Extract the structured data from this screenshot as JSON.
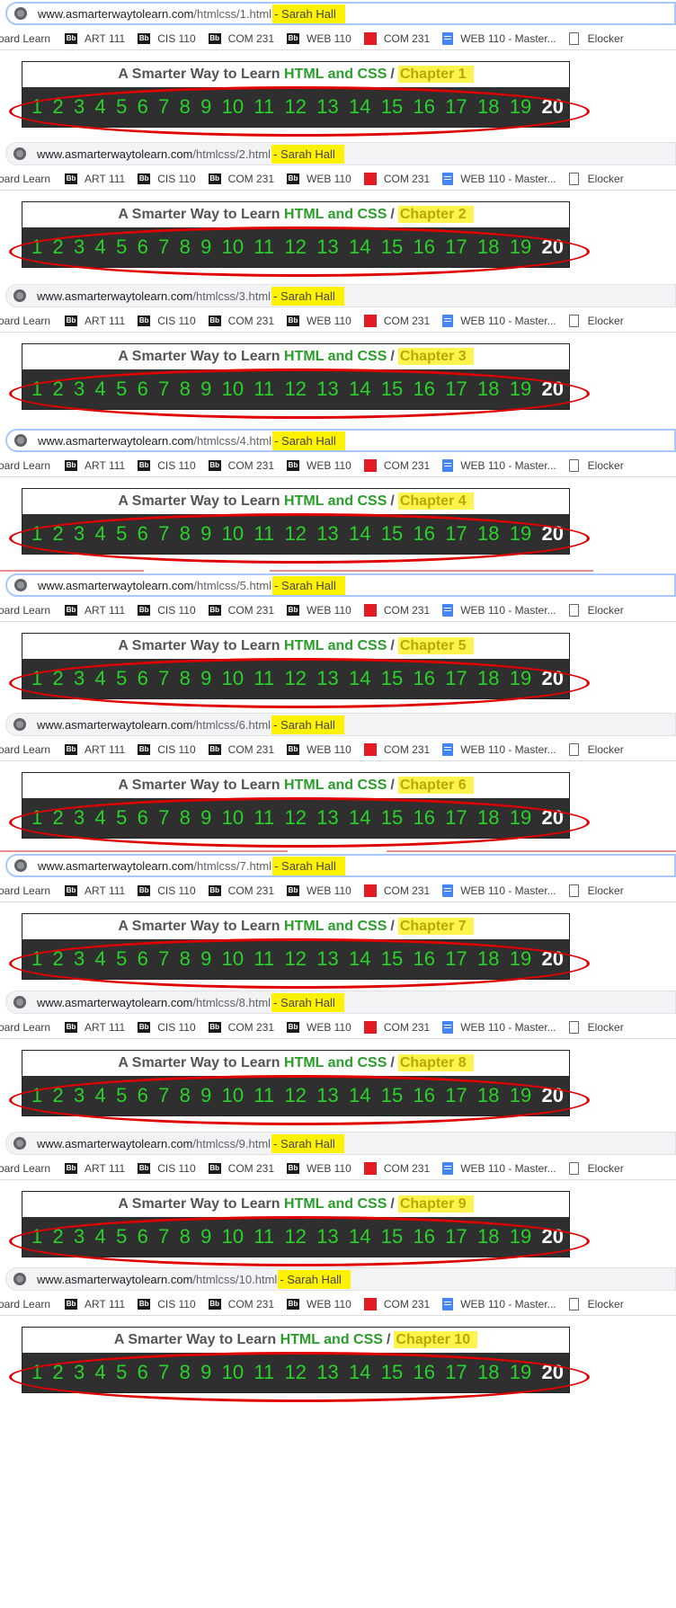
{
  "site": {
    "title_pre": "A Smarter Way to Learn",
    "title_green": "HTML and CSS",
    "separator": "/"
  },
  "url_domain": "www.asmarterwaytolearn.com",
  "highlight_text": "- Sarah Hall",
  "bookmarks": [
    {
      "label": "oard Learn",
      "icon": "none"
    },
    {
      "label": "ART 111",
      "icon": "blackboard-icon"
    },
    {
      "label": "CIS 110",
      "icon": "blackboard-icon"
    },
    {
      "label": "COM 231",
      "icon": "blackboard-icon"
    },
    {
      "label": "WEB 110",
      "icon": "blackboard-icon"
    },
    {
      "label": "COM 231",
      "icon": "mcgraw-hill-icon"
    },
    {
      "label": "WEB 110 - Master...",
      "icon": "google-docs-icon"
    },
    {
      "label": "Elocker",
      "icon": "page-icon"
    }
  ],
  "page_numbers": [
    "1",
    "2",
    "3",
    "4",
    "5",
    "6",
    "7",
    "8",
    "9",
    "10",
    "11",
    "12",
    "13",
    "14",
    "15",
    "16",
    "17",
    "18",
    "19",
    "20"
  ],
  "current_page": "20",
  "colors": {
    "highlight": "#fff200",
    "number_green": "#29d12a",
    "bar_bg": "#2f2f2f",
    "annotation_red": "#e00000",
    "title_green": "#2a9d2a"
  },
  "screenshots": [
    {
      "url_path": "/htmlcss/1.html",
      "chapter": "Chapter 1",
      "active": true
    },
    {
      "url_path": "/htmlcss/2.html",
      "chapter": "Chapter 2",
      "active": false
    },
    {
      "url_path": "/htmlcss/3.html",
      "chapter": "Chapter 3",
      "active": false
    },
    {
      "url_path": "/htmlcss/4.html",
      "chapter": "Chapter 4",
      "active": true
    },
    {
      "url_path": "/htmlcss/5.html",
      "chapter": "Chapter 5",
      "active": true
    },
    {
      "url_path": "/htmlcss/6.html",
      "chapter": "Chapter 6",
      "active": false
    },
    {
      "url_path": "/htmlcss/7.html",
      "chapter": "Chapter 7",
      "active": true
    },
    {
      "url_path": "/htmlcss/8.html",
      "chapter": "Chapter 8",
      "active": false
    },
    {
      "url_path": "/htmlcss/9.html",
      "chapter": "Chapter 9",
      "active": false
    },
    {
      "url_path": "/htmlcss/10.html",
      "chapter": "Chapter 10",
      "active": false
    }
  ]
}
